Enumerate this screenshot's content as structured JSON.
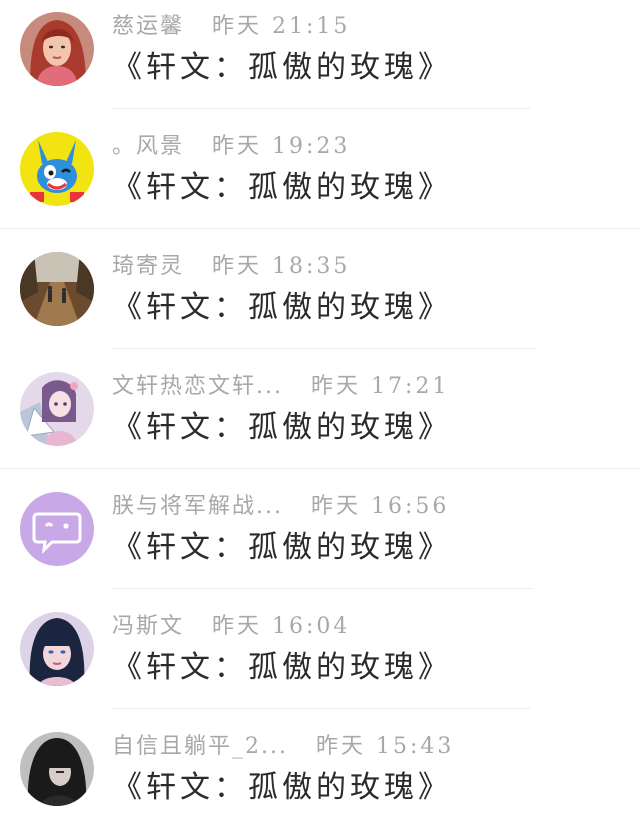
{
  "comments": [
    {
      "name": "慈运馨",
      "time": "昨天 21:15",
      "message": "《轩文：孤傲的玫瑰》",
      "avatar": "woman-red-hair-photo"
    },
    {
      "name": "。风景",
      "time": "昨天 19:23",
      "message": "《轩文：孤傲的玫瑰》",
      "avatar": "blue-cartoon-rabbit"
    },
    {
      "name": "琦寄灵",
      "time": "昨天 18:35",
      "message": "《轩文：孤傲的玫瑰》",
      "avatar": "autumn-path-photo"
    },
    {
      "name": "文轩热恋文轩...",
      "time": "昨天 17:21",
      "message": "《轩文：孤傲的玫瑰》",
      "avatar": "anime-girl-fan"
    },
    {
      "name": "朕与将军解战...",
      "time": "昨天 16:56",
      "message": "《轩文：孤傲的玫瑰》",
      "avatar": "purple-chat-bubble"
    },
    {
      "name": "冯斯文",
      "time": "昨天 16:04",
      "message": "《轩文：孤傲的玫瑰》",
      "avatar": "person-dark-hair-photo"
    },
    {
      "name": "自信且躺平_2...",
      "time": "昨天 15:43",
      "message": "《轩文：孤傲的玫瑰》",
      "avatar": "hooded-figure-photo"
    }
  ],
  "colors": {
    "name_gray": "#a8a8a8",
    "message_dark": "#2b2b2b",
    "divider": "#ececec",
    "bubble_purple": "#c9a8e8"
  }
}
